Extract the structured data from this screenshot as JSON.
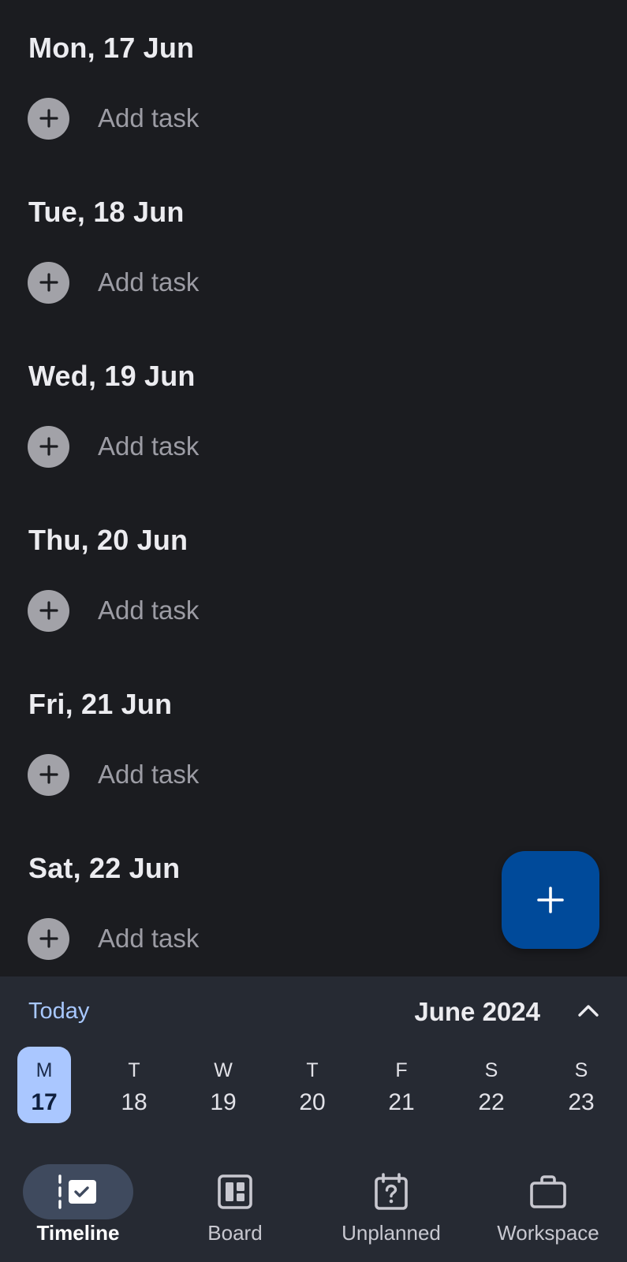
{
  "days": [
    {
      "heading": "Mon, 17 Jun",
      "add_label": "Add task"
    },
    {
      "heading": "Tue, 18 Jun",
      "add_label": "Add task"
    },
    {
      "heading": "Wed, 19 Jun",
      "add_label": "Add task"
    },
    {
      "heading": "Thu, 20 Jun",
      "add_label": "Add task"
    },
    {
      "heading": "Fri, 21 Jun",
      "add_label": "Add task"
    },
    {
      "heading": "Sat, 22 Jun",
      "add_label": "Add task"
    }
  ],
  "fab": {
    "icon": "plus-icon"
  },
  "calendar": {
    "today_label": "Today",
    "month_label": "June 2024",
    "collapse_icon": "chevron-up-icon",
    "week": [
      {
        "weekday": "M",
        "date": "17",
        "selected": true
      },
      {
        "weekday": "T",
        "date": "18"
      },
      {
        "weekday": "W",
        "date": "19"
      },
      {
        "weekday": "T",
        "date": "20"
      },
      {
        "weekday": "F",
        "date": "21"
      },
      {
        "weekday": "S",
        "date": "22"
      },
      {
        "weekday": "S",
        "date": "23"
      }
    ]
  },
  "nav": {
    "items": [
      {
        "label": "Timeline",
        "icon": "timeline-icon",
        "active": true
      },
      {
        "label": "Board",
        "icon": "board-icon"
      },
      {
        "label": "Unplanned",
        "icon": "unplanned-icon"
      },
      {
        "label": "Workspace",
        "icon": "briefcase-icon"
      }
    ]
  },
  "colors": {
    "background": "#1b1c20",
    "panel": "#262a33",
    "accent": "#aac7ff",
    "fab": "#004a9a"
  }
}
